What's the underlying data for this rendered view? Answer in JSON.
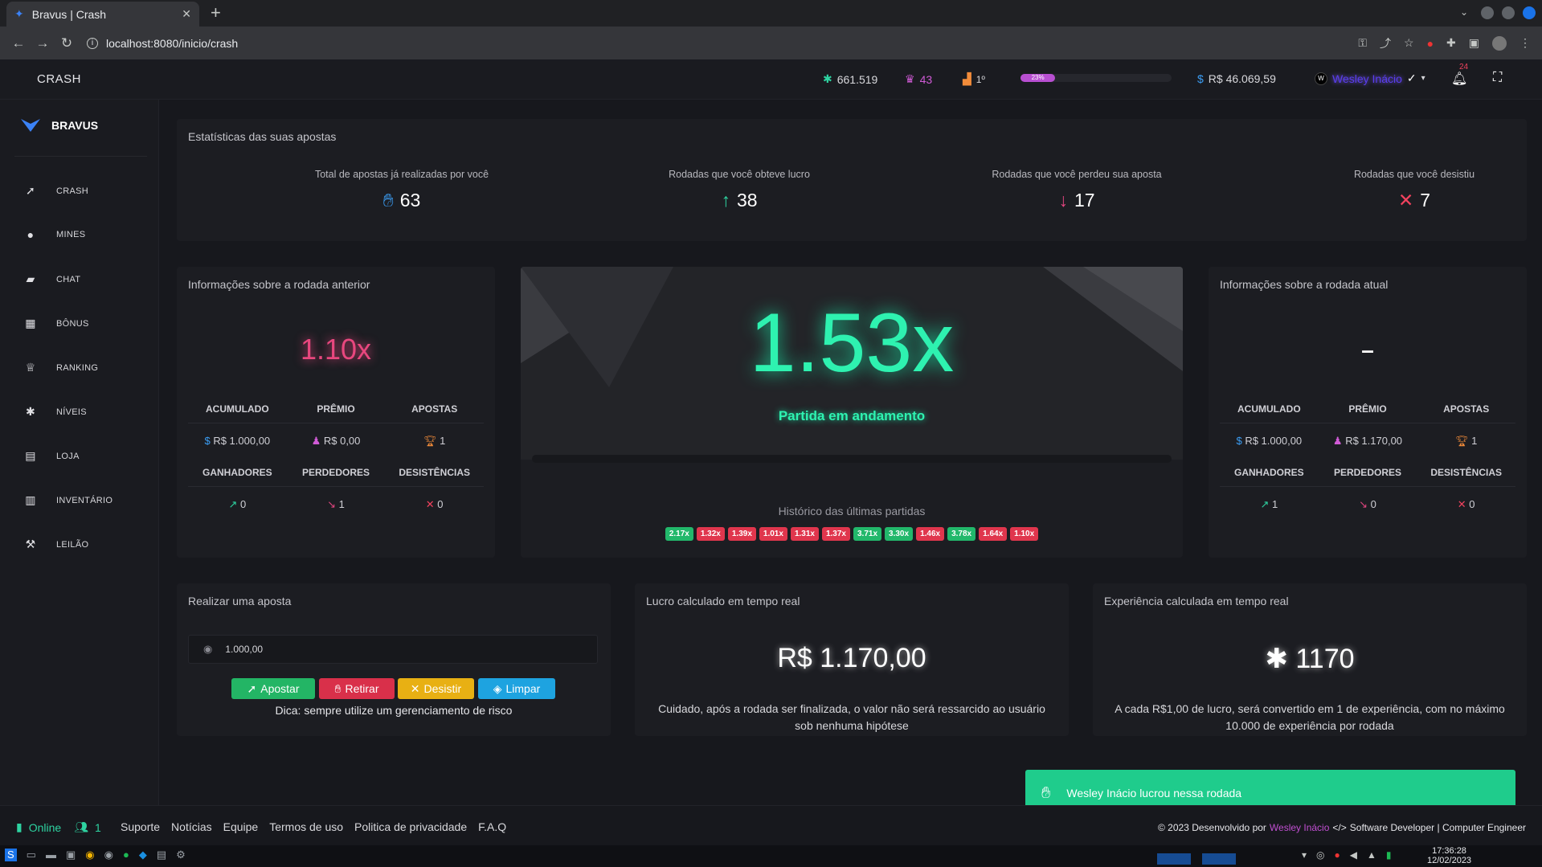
{
  "browser": {
    "tab_title": "Bravus | Crash",
    "url": "localhost:8080/inicio/crash"
  },
  "header": {
    "page_title": "CRASH",
    "xp": "661.519",
    "crown": "43",
    "rank": "1º",
    "level_progress_label": "23%",
    "level_progress": 0.23,
    "balance": "R$ 46.069,59",
    "username": "Wesley Inácio",
    "notif_count": "24"
  },
  "sidebar": {
    "brand": "BRAVUS",
    "items": [
      {
        "label": "CRASH",
        "icon": "rocket-icon"
      },
      {
        "label": "MINES",
        "icon": "bomb-icon"
      },
      {
        "label": "CHAT",
        "icon": "chat-icon"
      },
      {
        "label": "BÔNUS",
        "icon": "gift-icon"
      },
      {
        "label": "RANKING",
        "icon": "trophy-icon"
      },
      {
        "label": "NÍVEIS",
        "icon": "asterisk-icon"
      },
      {
        "label": "LOJA",
        "icon": "store-icon"
      },
      {
        "label": "INVENTÁRIO",
        "icon": "inventory-icon"
      },
      {
        "label": "LEILÃO",
        "icon": "gavel-icon"
      }
    ]
  },
  "stats": {
    "title": "Estatísticas das suas apostas",
    "items": [
      {
        "label": "Total de apostas já realizadas por você",
        "value": "63"
      },
      {
        "label": "Rodadas que você obteve lucro",
        "value": "38"
      },
      {
        "label": "Rodadas que você perdeu sua aposta",
        "value": "17"
      },
      {
        "label": "Rodadas que você desistiu",
        "value": "7"
      }
    ]
  },
  "previous_round": {
    "title": "Informações sobre a rodada anterior",
    "multiplier": "1.10x",
    "headers1": [
      "ACUMULADO",
      "PRÊMIO",
      "APOSTAS"
    ],
    "values1": [
      "R$ 1.000,00",
      "R$ 0,00",
      "1"
    ],
    "headers2": [
      "GANHADORES",
      "PERDEDORES",
      "DESISTÊNCIAS"
    ],
    "values2": [
      "0",
      "1",
      "0"
    ]
  },
  "game": {
    "multiplier": "1.53x",
    "status": "Partida em andamento",
    "history_title": "Histórico das últimas partidas",
    "history": [
      {
        "v": "2.17x",
        "c": "green"
      },
      {
        "v": "1.32x",
        "c": "red"
      },
      {
        "v": "1.39x",
        "c": "red"
      },
      {
        "v": "1.01x",
        "c": "red"
      },
      {
        "v": "1.31x",
        "c": "red"
      },
      {
        "v": "1.37x",
        "c": "red"
      },
      {
        "v": "3.71x",
        "c": "green"
      },
      {
        "v": "3.30x",
        "c": "green"
      },
      {
        "v": "1.46x",
        "c": "red"
      },
      {
        "v": "3.78x",
        "c": "green"
      },
      {
        "v": "1.64x",
        "c": "red"
      },
      {
        "v": "1.10x",
        "c": "red"
      }
    ]
  },
  "current_round": {
    "title": "Informações sobre a rodada atual",
    "multiplier": "–",
    "headers1": [
      "ACUMULADO",
      "PRÊMIO",
      "APOSTAS"
    ],
    "values1": [
      "R$ 1.000,00",
      "R$ 1.170,00",
      "1"
    ],
    "headers2": [
      "GANHADORES",
      "PERDEDORES",
      "DESISTÊNCIAS"
    ],
    "values2": [
      "1",
      "0",
      "0"
    ]
  },
  "bet": {
    "title": "Realizar uma aposta",
    "amount": "1.000,00",
    "buttons": {
      "apostar": "Apostar",
      "retirar": "Retirar",
      "desistir": "Desistir",
      "limpar": "Limpar"
    },
    "tip": "Dica: sempre utilize um gerenciamento de risco"
  },
  "profit": {
    "title": "Lucro calculado em tempo real",
    "value": "R$ 1.170,00",
    "note": "Cuidado, após a rodada ser finalizada, o valor não será ressarcido ao usuário sob nenhuma hipótese"
  },
  "experience": {
    "title": "Experiência calculada em tempo real",
    "value": "1170",
    "note": "A cada R$1,00 de lucro, será convertido em 1 de experiência, com no máximo 10.000 de experiência por rodada"
  },
  "toast": {
    "message": "Wesley Inácio lucrou nessa rodada"
  },
  "footer": {
    "online": "Online",
    "users": "1",
    "links": [
      "Suporte",
      "Notícias",
      "Equipe",
      "Termos de uso",
      "Politica de privacidade",
      "F.A.Q"
    ],
    "copyright_prefix": "© 2023 Desenvolvido por",
    "author": "Wesley Inácio",
    "copyright_suffix": "Software Developer | Computer Engineer"
  },
  "taskbar": {
    "time": "17:36:28",
    "date": "12/02/2023"
  }
}
